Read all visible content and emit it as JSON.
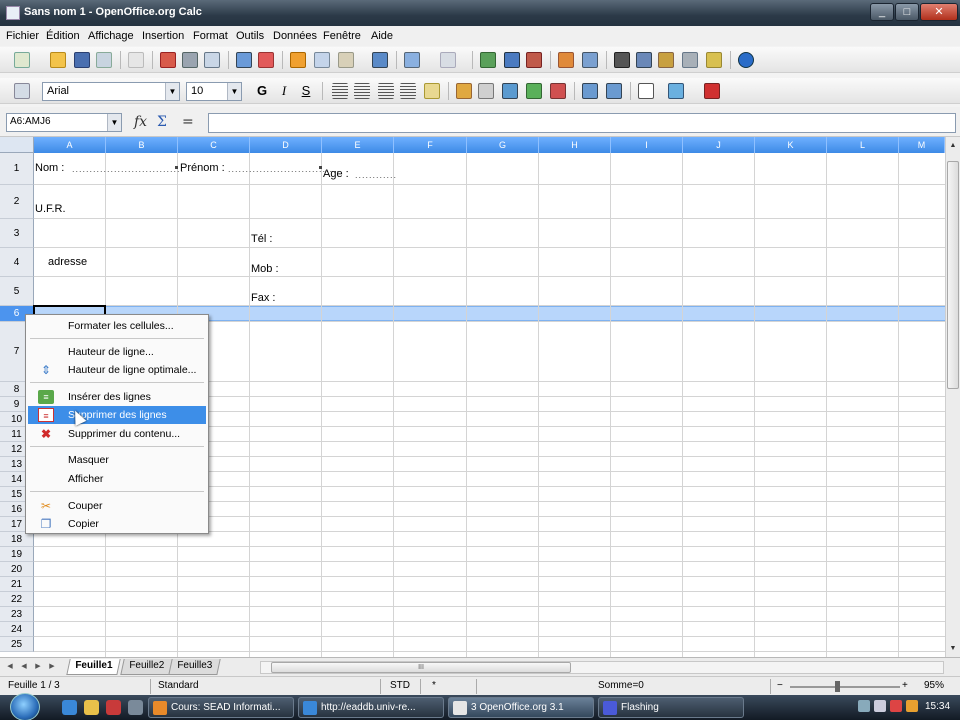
{
  "window": {
    "title": "Sans nom 1 - OpenOffice.org Calc",
    "min": "_",
    "max": "□",
    "close": "✕"
  },
  "menu": [
    "Fichier",
    "Édition",
    "Affichage",
    "Insertion",
    "Format",
    "Outils",
    "Données",
    "Fenêtre",
    "Aide"
  ],
  "format_bar": {
    "font": "Arial",
    "size": "10",
    "bold": "G",
    "italic": "I",
    "underline": "S"
  },
  "formula_bar": {
    "name_box": "A6:AMJ6",
    "fx": "fx",
    "sum": "Σ",
    "equals": "=",
    "content": ""
  },
  "columns": [
    "A",
    "B",
    "C",
    "D",
    "E",
    "F",
    "G",
    "H",
    "I",
    "J",
    "K",
    "L",
    "M"
  ],
  "rows": [
    "1",
    "2",
    "3",
    "4",
    "5",
    "6",
    "7",
    "8",
    "9",
    "10",
    "11",
    "12",
    "13",
    "14",
    "15",
    "16",
    "17",
    "18",
    "19",
    "20",
    "21",
    "22",
    "23",
    "24",
    "25"
  ],
  "cells": {
    "nom": "Nom :",
    "nom_dots": "................................",
    "prenom": "Prénom :",
    "prenom_dots": "................................",
    "age": "Age :",
    "age_dots": "............",
    "ufr": "U.F.R.",
    "tel": "Tél :",
    "mob": "Mob :",
    "fax": "Fax :",
    "adresse": "adresse"
  },
  "context_menu": {
    "items": [
      {
        "label": "Formater les cellules...",
        "icon": ""
      },
      {
        "label": "Hauteur de ligne...",
        "icon": ""
      },
      {
        "label": "Hauteur de ligne optimale...",
        "icon": "row-height-icon"
      },
      {
        "label": "Insérer des lignes",
        "icon": "insert-rows-icon"
      },
      {
        "label": "Supprimer des lignes",
        "icon": "delete-rows-icon"
      },
      {
        "label": "Supprimer du contenu...",
        "icon": "delete-content-icon"
      },
      {
        "label": "Masquer",
        "icon": ""
      },
      {
        "label": "Afficher",
        "icon": ""
      },
      {
        "label": "Couper",
        "icon": "cut-icon"
      },
      {
        "label": "Copier",
        "icon": "copy-icon"
      }
    ],
    "highlighted_index": 4
  },
  "sheets": [
    "Feuille1",
    "Feuille2",
    "Feuille3"
  ],
  "active_sheet": "Feuille1",
  "hscroll_grip": "III",
  "status": {
    "sheet": "Feuille 1 / 3",
    "style": "Standard",
    "mode": "STD",
    "modified": "*",
    "sum": "Somme=0",
    "zoom": "95%",
    "zoom_minus": "−",
    "zoom_plus": "+"
  },
  "taskbar": {
    "tasks": [
      {
        "label": "Cours: SEAD Informati...",
        "active": false
      },
      {
        "label": "http://eaddb.univ-re...",
        "active": false
      },
      {
        "label": "3 OpenOffice.org 3.1",
        "active": true
      },
      {
        "label": "Flashing",
        "active": false
      }
    ],
    "clock": "15:34"
  },
  "colors": {
    "accent": "#3d8ee8",
    "column_header": "#4a96f0",
    "selected_row": "#b8d6fb"
  }
}
